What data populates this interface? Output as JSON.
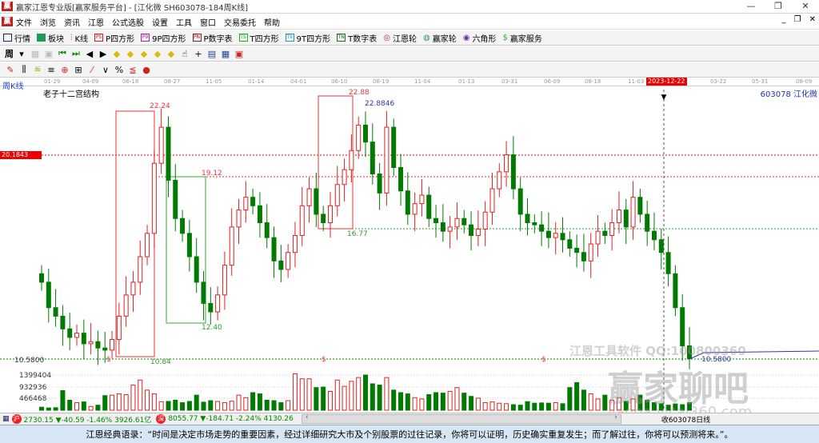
{
  "window": {
    "title": "赢家江恩专业版[赢家服务平台] - [江化微  SH603078-184周K线]",
    "logo": "赢"
  },
  "menu": [
    "文件",
    "浏览",
    "资讯",
    "江恩",
    "公式选股",
    "设置",
    "工具",
    "窗口",
    "交易委托",
    "帮助"
  ],
  "toolbar": [
    {
      "icon": "grid",
      "label": "行情"
    },
    {
      "icon": "blocks",
      "label": "板块"
    },
    {
      "icon": "candles",
      "label": "K线"
    },
    {
      "icon": "PS",
      "label": "P四方形"
    },
    {
      "icon": "P9",
      "label": "9P四方形"
    },
    {
      "icon": "PN",
      "label": "P数字表"
    },
    {
      "icon": "TS",
      "label": "T四方形"
    },
    {
      "icon": "T9",
      "label": "9T四方形"
    },
    {
      "icon": "TN",
      "label": "T数字表"
    },
    {
      "icon": "target",
      "label": "江恩轮"
    },
    {
      "icon": "wheel",
      "label": "赢家轮"
    },
    {
      "icon": "hexagon",
      "label": "六角形"
    },
    {
      "icon": "$",
      "label": "赢家服务"
    }
  ],
  "period_button": "周",
  "period_label": "周K线",
  "time_axis": [
    "01-29",
    "04-09",
    "06-18",
    "08-27",
    "11-05",
    "01-14",
    "04-01",
    "06-10",
    "08-19",
    "11-04",
    "01-13",
    "03-31",
    "06-09",
    "08-18",
    "11-03",
    "03-22",
    "05-31",
    "08-09"
  ],
  "cursor_date": "2023-12-22",
  "chart_title": "老子十二宫结构",
  "stock_label": "603078 江化微",
  "cursor_price": "20.1843",
  "bottom_price": "10.5800",
  "annotations": {
    "p1": "22.24",
    "p2": "19.12",
    "p3": "12.40",
    "p4": "10.84",
    "p5": "22.88",
    "p6": "22.8846",
    "p7": "16.77",
    "p8": "10.5800",
    "dollar": "$"
  },
  "volume_axis": [
    "1399404",
    "932936",
    "466468"
  ],
  "watermarks": {
    "w1": "江恩工具软件  QQ:100800360",
    "w2": "赢家聊吧",
    "w3": "liaoba.yicai360.com"
  },
  "status": {
    "idx1": "2730.15 ▼-40.59 -1.46% 3926.61亿",
    "idx2": "8055.77 ▼-184.71 -2.24% 4130.26",
    "right": "收603078日线"
  },
  "quote": "江恩经典语录：“时间是决定市场走势的重要因素，经过详细研究大市及个别股票的过往记录，你将可以证明，历史确实重复发生；而了解过往，你将可以预测将来。”。",
  "colors": {
    "up": "#e02020",
    "down": "#007a00",
    "accent": "#e00000"
  },
  "chart_data": {
    "type": "candlestick",
    "ylim": [
      10.58,
      23.5
    ],
    "closes": [
      14.2,
      13.0,
      12.6,
      12.0,
      11.6,
      11.8,
      11.3,
      11.4,
      11.1,
      11.0,
      11.5,
      12.6,
      13.6,
      14.2,
      15.4,
      16.5,
      19.8,
      21.5,
      19.0,
      17.2,
      16.5,
      15.4,
      14.2,
      13.2,
      12.8,
      13.6,
      15.0,
      16.8,
      17.6,
      18.2,
      17.8,
      17.0,
      16.3,
      15.2,
      14.8,
      15.6,
      16.4,
      17.8,
      18.6,
      17.4,
      17.0,
      17.8,
      18.8,
      19.5,
      20.4,
      21.6,
      20.8,
      19.3,
      18.4,
      21.5,
      19.6,
      18.5,
      17.4,
      17.9,
      18.3,
      17.2,
      17.0,
      16.6,
      16.8,
      17.2,
      16.9,
      16.4,
      16.7,
      17.5,
      18.6,
      19.4,
      20.2,
      18.6,
      17.4,
      17.0,
      16.9,
      16.6,
      16.3,
      16.5,
      16.2,
      15.8,
      15.6,
      15.2,
      16.0,
      16.6,
      16.4,
      17.0,
      17.6,
      16.8,
      18.2,
      17.4,
      16.6,
      16.2,
      15.6,
      14.6,
      13.0,
      11.2,
      10.6
    ],
    "volumes": [
      120,
      90,
      100,
      780,
      400,
      300,
      330,
      150,
      200,
      580,
      600,
      650,
      620,
      1000,
      1200,
      800,
      650,
      340,
      350,
      400,
      300,
      350,
      600,
      320,
      380,
      350,
      300,
      360,
      600,
      500,
      700,
      650,
      400,
      380,
      300,
      380,
      1450,
      1250,
      1250,
      900,
      920,
      750,
      1200,
      950,
      1150,
      1300,
      1400,
      1050,
      1000,
      1300,
      800,
      700,
      650,
      500,
      450,
      620,
      700,
      680,
      750,
      900,
      680,
      550,
      480,
      300,
      330,
      280,
      260,
      220,
      200,
      340,
      280,
      290,
      280,
      300,
      260,
      900,
      1100,
      800,
      650,
      450,
      600,
      400,
      500,
      350,
      450,
      600,
      400,
      300,
      260,
      200,
      250,
      220,
      300
    ]
  }
}
